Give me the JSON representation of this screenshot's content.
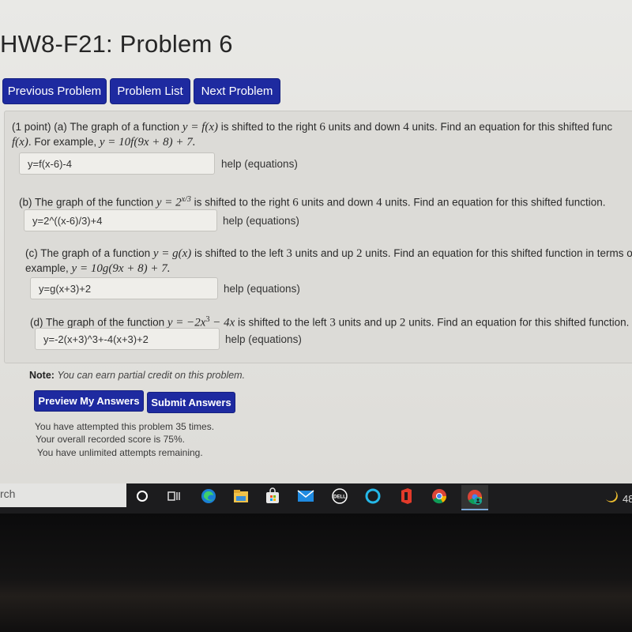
{
  "page": {
    "title": "HW8-F21: Problem 6"
  },
  "nav": {
    "previous_label": "Previous Problem",
    "list_label": "Problem List",
    "next_label": "Next Problem"
  },
  "problem": {
    "points": "(1 point)",
    "parts": [
      {
        "label": "(a)",
        "text_before": "The graph of a function",
        "math_func": "y = f(x)",
        "text_after_1": "is shifted to the right",
        "shift_h": "6",
        "text_after_2": "units and down",
        "shift_v": "4",
        "text_after_3": "units. Find an equation for this shifted func",
        "line2_math": "f(x)",
        "line2_text": ". For example,",
        "example": "y = 10f(9x + 8) + 7.",
        "answer": "y=f(x-6)-4",
        "help": "help (equations)"
      },
      {
        "label": "(b)",
        "text_before": "The graph of the function",
        "math_func": "y = 2",
        "exponent": "x/3",
        "text_after_1": "is shifted to the right",
        "shift_h": "6",
        "text_after_2": "units and down",
        "shift_v": "4",
        "text_after_3": "units. Find an equation for this shifted function.",
        "answer": "y=2^((x-6)/3)+4",
        "help": "help (equations)"
      },
      {
        "label": "(c)",
        "text_before": "The graph of a function",
        "math_func": "y = g(x)",
        "text_after_1": "is shifted to the left",
        "shift_h": "3",
        "text_after_2": "units and up",
        "shift_v": "2",
        "text_after_3": "units. Find an equation for this shifted function in terms of th",
        "line2_text": "example,",
        "example": "y = 10g(9x + 8) + 7.",
        "answer": "y=g(x+3)+2",
        "help": "help (equations)"
      },
      {
        "label": "(d)",
        "text_before": "The graph of the function",
        "math_func": "y = −2x",
        "exponent": "3",
        "math_tail": " − 4x",
        "text_after_1": "is shifted to the left",
        "shift_h": "3",
        "text_after_2": "units and up",
        "shift_v": "2",
        "text_after_3": "units. Find an equation for this shifted function.",
        "answer": "y=-2(x+3)^3+-4(x+3)+2",
        "help": "help (equations)"
      }
    ]
  },
  "note": {
    "label": "Note:",
    "text": "You can earn partial credit on this problem."
  },
  "actions": {
    "preview_label": "Preview My Answers",
    "submit_label": "Submit Answers"
  },
  "status": {
    "attempts": "You have attempted this problem 35 times.",
    "score": "Your overall recorded score is 75%.",
    "remaining": "You have unlimited attempts remaining."
  },
  "taskbar": {
    "search_text": "rch",
    "icons": [
      "cortana-icon",
      "task-view-icon",
      "edge-icon",
      "file-explorer-icon",
      "store-icon",
      "mail-icon",
      "dell-icon",
      "alexa-icon",
      "office-icon",
      "chrome-icon",
      "chrome-profile-icon"
    ],
    "weather_temp": "48"
  },
  "colors": {
    "button_blue": "#1e2aa0",
    "taskbar": "#1c1c1e"
  }
}
